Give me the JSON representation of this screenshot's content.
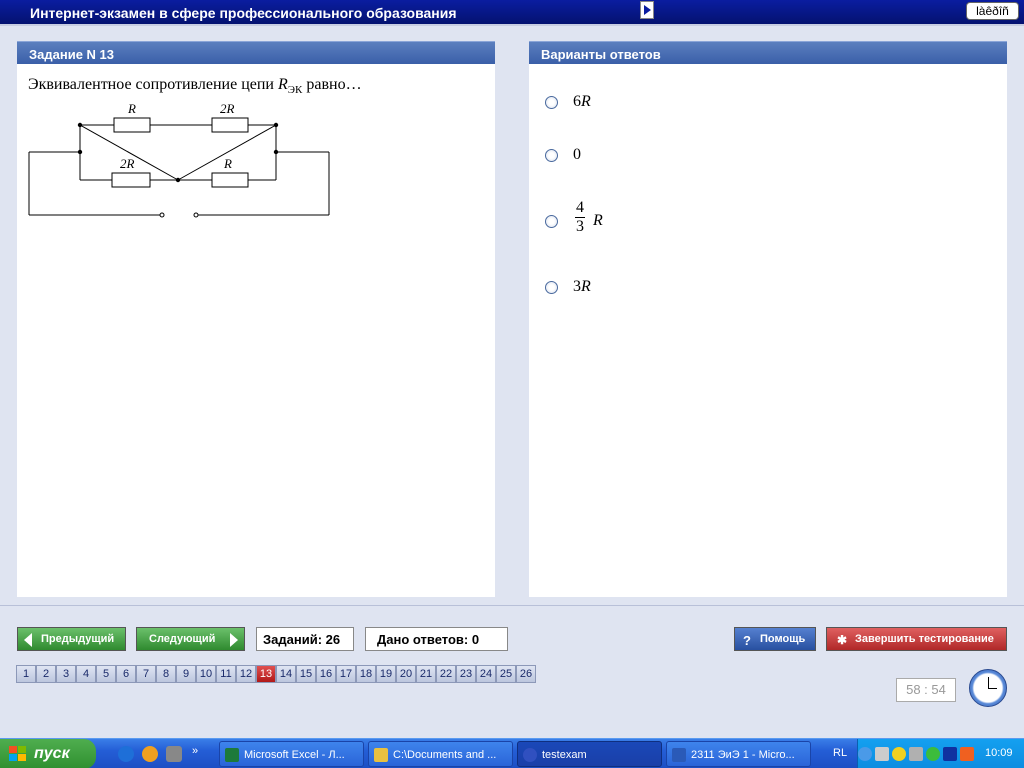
{
  "window": {
    "title": "Интернет-экзамен в сфере профессионального образования",
    "lang_button": "làêðîñ"
  },
  "question": {
    "header": "Задание N 13",
    "text_before": "Эквивалентное сопротивление цепи",
    "symbol": "R",
    "subscript": "ЭК",
    "text_after": "равно…",
    "circuit": {
      "top_left": "R",
      "top_right": "2R",
      "bottom_left": "2R",
      "bottom_right": "R"
    }
  },
  "answers": {
    "header": "Варианты ответов",
    "options": [
      {
        "coef": "6",
        "var": "R"
      },
      {
        "coef": "0",
        "var": ""
      },
      {
        "num": "4",
        "den": "3",
        "var": "R"
      },
      {
        "coef": "3",
        "var": "R"
      }
    ]
  },
  "nav": {
    "prev": "Предыдущий",
    "next": "Следующий",
    "total": "Заданий: 26",
    "answered": "Дано ответов: 0",
    "help": "Помощь",
    "finish": "Завершить тестирование",
    "current": 13,
    "numbers": [
      "1",
      "2",
      "3",
      "4",
      "5",
      "6",
      "7",
      "8",
      "9",
      "10",
      "11",
      "12",
      "13",
      "14",
      "15",
      "16",
      "17",
      "18",
      "19",
      "20",
      "21",
      "22",
      "23",
      "24",
      "25",
      "26"
    ]
  },
  "timer": "58 : 54",
  "taskbar": {
    "start": "пуск",
    "tasks": [
      {
        "label": "Microsoft Excel - Л...",
        "icon_color": "#1d7a3a"
      },
      {
        "label": "C:\\Documents and ...",
        "icon_color": "#e8c040"
      },
      {
        "label": "testexam",
        "icon_color": "#3050c0"
      },
      {
        "label": "2311 ЭиЭ 1 - Micro...",
        "icon_color": "#2a5ab8"
      }
    ],
    "lang": "RL",
    "time": "10:09"
  }
}
